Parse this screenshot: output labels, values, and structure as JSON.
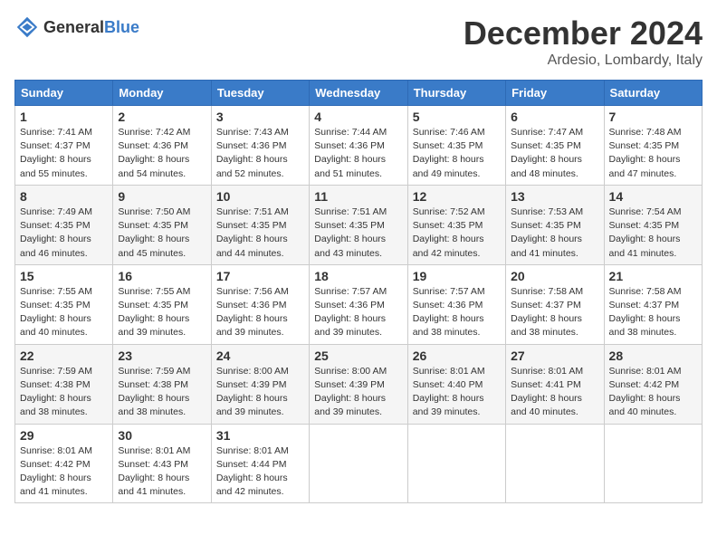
{
  "header": {
    "logo": {
      "general": "General",
      "blue": "Blue"
    },
    "month": "December 2024",
    "location": "Ardesio, Lombardy, Italy"
  },
  "calendar": {
    "days_of_week": [
      "Sunday",
      "Monday",
      "Tuesday",
      "Wednesday",
      "Thursday",
      "Friday",
      "Saturday"
    ],
    "weeks": [
      [
        null,
        null,
        null,
        null,
        null,
        null,
        null
      ]
    ],
    "cells": [
      {
        "day": 1,
        "dow": 0,
        "sunrise": "7:41 AM",
        "sunset": "4:37 PM",
        "daylight": "8 hours and 55 minutes."
      },
      {
        "day": 2,
        "dow": 1,
        "sunrise": "7:42 AM",
        "sunset": "4:36 PM",
        "daylight": "8 hours and 54 minutes."
      },
      {
        "day": 3,
        "dow": 2,
        "sunrise": "7:43 AM",
        "sunset": "4:36 PM",
        "daylight": "8 hours and 52 minutes."
      },
      {
        "day": 4,
        "dow": 3,
        "sunrise": "7:44 AM",
        "sunset": "4:36 PM",
        "daylight": "8 hours and 51 minutes."
      },
      {
        "day": 5,
        "dow": 4,
        "sunrise": "7:46 AM",
        "sunset": "4:35 PM",
        "daylight": "8 hours and 49 minutes."
      },
      {
        "day": 6,
        "dow": 5,
        "sunrise": "7:47 AM",
        "sunset": "4:35 PM",
        "daylight": "8 hours and 48 minutes."
      },
      {
        "day": 7,
        "dow": 6,
        "sunrise": "7:48 AM",
        "sunset": "4:35 PM",
        "daylight": "8 hours and 47 minutes."
      },
      {
        "day": 8,
        "dow": 0,
        "sunrise": "7:49 AM",
        "sunset": "4:35 PM",
        "daylight": "8 hours and 46 minutes."
      },
      {
        "day": 9,
        "dow": 1,
        "sunrise": "7:50 AM",
        "sunset": "4:35 PM",
        "daylight": "8 hours and 45 minutes."
      },
      {
        "day": 10,
        "dow": 2,
        "sunrise": "7:51 AM",
        "sunset": "4:35 PM",
        "daylight": "8 hours and 44 minutes."
      },
      {
        "day": 11,
        "dow": 3,
        "sunrise": "7:51 AM",
        "sunset": "4:35 PM",
        "daylight": "8 hours and 43 minutes."
      },
      {
        "day": 12,
        "dow": 4,
        "sunrise": "7:52 AM",
        "sunset": "4:35 PM",
        "daylight": "8 hours and 42 minutes."
      },
      {
        "day": 13,
        "dow": 5,
        "sunrise": "7:53 AM",
        "sunset": "4:35 PM",
        "daylight": "8 hours and 41 minutes."
      },
      {
        "day": 14,
        "dow": 6,
        "sunrise": "7:54 AM",
        "sunset": "4:35 PM",
        "daylight": "8 hours and 41 minutes."
      },
      {
        "day": 15,
        "dow": 0,
        "sunrise": "7:55 AM",
        "sunset": "4:35 PM",
        "daylight": "8 hours and 40 minutes."
      },
      {
        "day": 16,
        "dow": 1,
        "sunrise": "7:55 AM",
        "sunset": "4:35 PM",
        "daylight": "8 hours and 39 minutes."
      },
      {
        "day": 17,
        "dow": 2,
        "sunrise": "7:56 AM",
        "sunset": "4:36 PM",
        "daylight": "8 hours and 39 minutes."
      },
      {
        "day": 18,
        "dow": 3,
        "sunrise": "7:57 AM",
        "sunset": "4:36 PM",
        "daylight": "8 hours and 39 minutes."
      },
      {
        "day": 19,
        "dow": 4,
        "sunrise": "7:57 AM",
        "sunset": "4:36 PM",
        "daylight": "8 hours and 38 minutes."
      },
      {
        "day": 20,
        "dow": 5,
        "sunrise": "7:58 AM",
        "sunset": "4:37 PM",
        "daylight": "8 hours and 38 minutes."
      },
      {
        "day": 21,
        "dow": 6,
        "sunrise": "7:58 AM",
        "sunset": "4:37 PM",
        "daylight": "8 hours and 38 minutes."
      },
      {
        "day": 22,
        "dow": 0,
        "sunrise": "7:59 AM",
        "sunset": "4:38 PM",
        "daylight": "8 hours and 38 minutes."
      },
      {
        "day": 23,
        "dow": 1,
        "sunrise": "7:59 AM",
        "sunset": "4:38 PM",
        "daylight": "8 hours and 38 minutes."
      },
      {
        "day": 24,
        "dow": 2,
        "sunrise": "8:00 AM",
        "sunset": "4:39 PM",
        "daylight": "8 hours and 39 minutes."
      },
      {
        "day": 25,
        "dow": 3,
        "sunrise": "8:00 AM",
        "sunset": "4:39 PM",
        "daylight": "8 hours and 39 minutes."
      },
      {
        "day": 26,
        "dow": 4,
        "sunrise": "8:01 AM",
        "sunset": "4:40 PM",
        "daylight": "8 hours and 39 minutes."
      },
      {
        "day": 27,
        "dow": 5,
        "sunrise": "8:01 AM",
        "sunset": "4:41 PM",
        "daylight": "8 hours and 40 minutes."
      },
      {
        "day": 28,
        "dow": 6,
        "sunrise": "8:01 AM",
        "sunset": "4:42 PM",
        "daylight": "8 hours and 40 minutes."
      },
      {
        "day": 29,
        "dow": 0,
        "sunrise": "8:01 AM",
        "sunset": "4:42 PM",
        "daylight": "8 hours and 41 minutes."
      },
      {
        "day": 30,
        "dow": 1,
        "sunrise": "8:01 AM",
        "sunset": "4:43 PM",
        "daylight": "8 hours and 41 minutes."
      },
      {
        "day": 31,
        "dow": 2,
        "sunrise": "8:01 AM",
        "sunset": "4:44 PM",
        "daylight": "8 hours and 42 minutes."
      }
    ]
  }
}
